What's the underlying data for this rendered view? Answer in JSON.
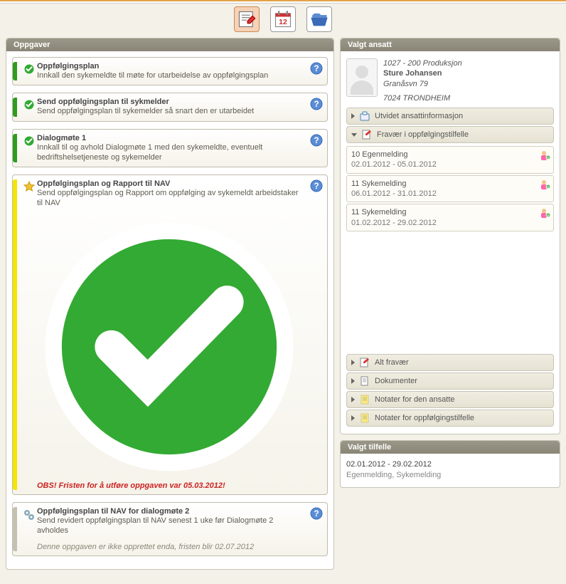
{
  "panels": {
    "tasks_title": "Oppgaver",
    "employee_title": "Valgt ansatt",
    "tilfelle_title": "Valgt tilfelle"
  },
  "tasks": [
    {
      "title": "Oppfølgingsplan",
      "desc": "Innkall den sykemeldte til møte for utarbeidelse av oppfølgingsplan",
      "stripe": "green",
      "icon": "check"
    },
    {
      "title": "Send oppfølgingsplan til sykmelder",
      "desc": "Send oppfølgingsplan til sykemelder så snart den er utarbeidet",
      "stripe": "green",
      "icon": "check"
    },
    {
      "title": "Dialogmøte 1",
      "desc": "Innkall til og avhold Dialogmøte 1 med den sykemeldte, eventuelt bedriftshelsetjeneste og sykemelder",
      "stripe": "green",
      "icon": "check"
    },
    {
      "title": "Oppfølgingsplan og Rapport til NAV",
      "desc": "Send oppfølgingsplan og Rapport om oppfølging av sykemeldt arbeidstaker til NAV",
      "stripe": "yellow",
      "icon": "star",
      "warning": "OBS! Fristen for å utføre oppgaven var 05.03.2012!"
    },
    {
      "title": "Oppfølgingsplan til NAV for dialogmøte 2",
      "desc": "Send revidert oppfølgingsplan til NAV senest 1 uke før Dialogmøte 2 avholdes",
      "stripe": "gray",
      "icon": "gears",
      "note": "Denne oppgaven er ikke opprettet enda, fristen blir 02.07.2012"
    }
  ],
  "employee": {
    "dept": "1027 - 200 Produksjon",
    "name": "Sture Johansen",
    "address1": "Granåsvn 79",
    "address2": "7024 TRONDHEIM"
  },
  "accordion": {
    "ext_info": "Utvidet ansattinformasjon",
    "fravaer_section": "Fravær i oppfølgingstilfelle",
    "alt_fravaer": "Alt fravær",
    "dokumenter": "Dokumenter",
    "notater_ansatt": "Notater for den ansatte",
    "notater_tilfelle": "Notater for oppfølgingstilfelle"
  },
  "absences": [
    {
      "title": "10 Egenmelding",
      "dates": "02.01.2012 - 05.01.2012"
    },
    {
      "title": "11 Sykemelding",
      "dates": "06.01.2012 - 31.01.2012"
    },
    {
      "title": "11 Sykemelding",
      "dates": "01.02.2012 - 29.02.2012"
    }
  ],
  "tilfelle": {
    "dates": "02.01.2012 - 29.02.2012",
    "types": "Egenmelding, Sykemelding"
  }
}
